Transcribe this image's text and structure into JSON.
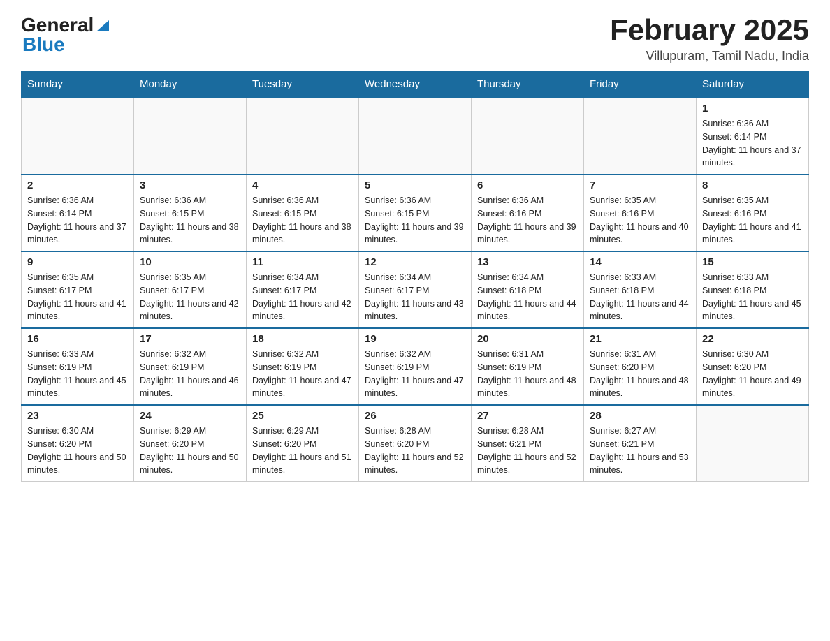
{
  "header": {
    "logo": {
      "general": "General",
      "blue": "Blue"
    },
    "title": "February 2025",
    "location": "Villupuram, Tamil Nadu, India"
  },
  "weekdays": [
    "Sunday",
    "Monday",
    "Tuesday",
    "Wednesday",
    "Thursday",
    "Friday",
    "Saturday"
  ],
  "weeks": [
    [
      {
        "day": "",
        "info": ""
      },
      {
        "day": "",
        "info": ""
      },
      {
        "day": "",
        "info": ""
      },
      {
        "day": "",
        "info": ""
      },
      {
        "day": "",
        "info": ""
      },
      {
        "day": "",
        "info": ""
      },
      {
        "day": "1",
        "info": "Sunrise: 6:36 AM\nSunset: 6:14 PM\nDaylight: 11 hours and 37 minutes."
      }
    ],
    [
      {
        "day": "2",
        "info": "Sunrise: 6:36 AM\nSunset: 6:14 PM\nDaylight: 11 hours and 37 minutes."
      },
      {
        "day": "3",
        "info": "Sunrise: 6:36 AM\nSunset: 6:15 PM\nDaylight: 11 hours and 38 minutes."
      },
      {
        "day": "4",
        "info": "Sunrise: 6:36 AM\nSunset: 6:15 PM\nDaylight: 11 hours and 38 minutes."
      },
      {
        "day": "5",
        "info": "Sunrise: 6:36 AM\nSunset: 6:15 PM\nDaylight: 11 hours and 39 minutes."
      },
      {
        "day": "6",
        "info": "Sunrise: 6:36 AM\nSunset: 6:16 PM\nDaylight: 11 hours and 39 minutes."
      },
      {
        "day": "7",
        "info": "Sunrise: 6:35 AM\nSunset: 6:16 PM\nDaylight: 11 hours and 40 minutes."
      },
      {
        "day": "8",
        "info": "Sunrise: 6:35 AM\nSunset: 6:16 PM\nDaylight: 11 hours and 41 minutes."
      }
    ],
    [
      {
        "day": "9",
        "info": "Sunrise: 6:35 AM\nSunset: 6:17 PM\nDaylight: 11 hours and 41 minutes."
      },
      {
        "day": "10",
        "info": "Sunrise: 6:35 AM\nSunset: 6:17 PM\nDaylight: 11 hours and 42 minutes."
      },
      {
        "day": "11",
        "info": "Sunrise: 6:34 AM\nSunset: 6:17 PM\nDaylight: 11 hours and 42 minutes."
      },
      {
        "day": "12",
        "info": "Sunrise: 6:34 AM\nSunset: 6:17 PM\nDaylight: 11 hours and 43 minutes."
      },
      {
        "day": "13",
        "info": "Sunrise: 6:34 AM\nSunset: 6:18 PM\nDaylight: 11 hours and 44 minutes."
      },
      {
        "day": "14",
        "info": "Sunrise: 6:33 AM\nSunset: 6:18 PM\nDaylight: 11 hours and 44 minutes."
      },
      {
        "day": "15",
        "info": "Sunrise: 6:33 AM\nSunset: 6:18 PM\nDaylight: 11 hours and 45 minutes."
      }
    ],
    [
      {
        "day": "16",
        "info": "Sunrise: 6:33 AM\nSunset: 6:19 PM\nDaylight: 11 hours and 45 minutes."
      },
      {
        "day": "17",
        "info": "Sunrise: 6:32 AM\nSunset: 6:19 PM\nDaylight: 11 hours and 46 minutes."
      },
      {
        "day": "18",
        "info": "Sunrise: 6:32 AM\nSunset: 6:19 PM\nDaylight: 11 hours and 47 minutes."
      },
      {
        "day": "19",
        "info": "Sunrise: 6:32 AM\nSunset: 6:19 PM\nDaylight: 11 hours and 47 minutes."
      },
      {
        "day": "20",
        "info": "Sunrise: 6:31 AM\nSunset: 6:19 PM\nDaylight: 11 hours and 48 minutes."
      },
      {
        "day": "21",
        "info": "Sunrise: 6:31 AM\nSunset: 6:20 PM\nDaylight: 11 hours and 48 minutes."
      },
      {
        "day": "22",
        "info": "Sunrise: 6:30 AM\nSunset: 6:20 PM\nDaylight: 11 hours and 49 minutes."
      }
    ],
    [
      {
        "day": "23",
        "info": "Sunrise: 6:30 AM\nSunset: 6:20 PM\nDaylight: 11 hours and 50 minutes."
      },
      {
        "day": "24",
        "info": "Sunrise: 6:29 AM\nSunset: 6:20 PM\nDaylight: 11 hours and 50 minutes."
      },
      {
        "day": "25",
        "info": "Sunrise: 6:29 AM\nSunset: 6:20 PM\nDaylight: 11 hours and 51 minutes."
      },
      {
        "day": "26",
        "info": "Sunrise: 6:28 AM\nSunset: 6:20 PM\nDaylight: 11 hours and 52 minutes."
      },
      {
        "day": "27",
        "info": "Sunrise: 6:28 AM\nSunset: 6:21 PM\nDaylight: 11 hours and 52 minutes."
      },
      {
        "day": "28",
        "info": "Sunrise: 6:27 AM\nSunset: 6:21 PM\nDaylight: 11 hours and 53 minutes."
      },
      {
        "day": "",
        "info": ""
      }
    ]
  ]
}
